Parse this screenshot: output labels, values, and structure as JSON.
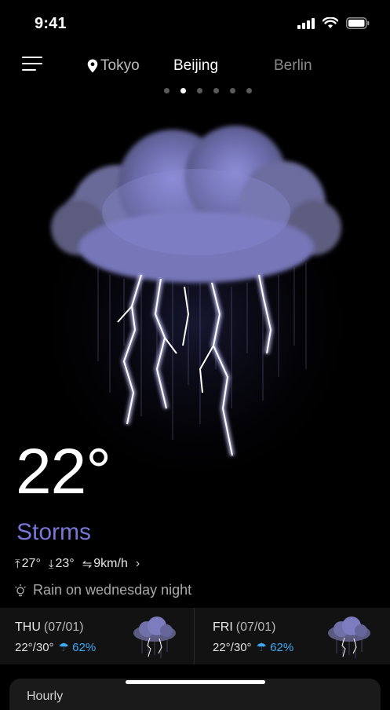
{
  "status_bar": {
    "time": "9:41",
    "icons": [
      "signal-icon",
      "wifi-icon",
      "battery-icon"
    ]
  },
  "nav": {
    "cities": [
      {
        "name": "Tokyo",
        "has_location_icon": true
      },
      {
        "name": "Beijing",
        "active": true
      },
      {
        "name": "Berlin"
      }
    ],
    "page_count": 6,
    "active_page": 1
  },
  "current": {
    "temperature": "22°",
    "condition": "Storms",
    "high": "27°",
    "low": "23°",
    "wind": "9km/h",
    "alert": "Rain on wednesday night"
  },
  "forecast": [
    {
      "day": "THU",
      "date": "(07/01)",
      "range": "22°/30°",
      "precip": "62%",
      "icon": "storm-cloud-icon"
    },
    {
      "day": "FRI",
      "date": "(07/01)",
      "range": "22°/30°",
      "precip": "62%",
      "icon": "storm-cloud-icon"
    }
  ],
  "bottom_sheet": {
    "label": "Hourly"
  },
  "colors": {
    "accent_condition": "#7777d8",
    "precip": "#3fa9f5",
    "background": "#000000"
  }
}
